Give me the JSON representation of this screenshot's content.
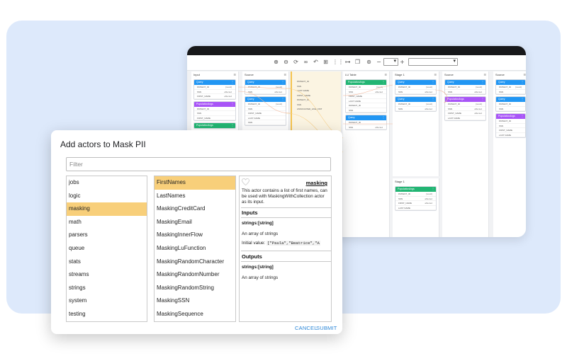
{
  "editor": {
    "columns": [
      {
        "title": "Input",
        "nodes": [
          {
            "title": "Query",
            "color": "#2196f3",
            "rows": [
              [
                "PATIENT_ID",
                "[result]"
              ],
              [
                "SSN",
                "affected"
              ],
              [
                "FIRST_NAME",
                "affected"
              ]
            ]
          },
          {
            "title": "PopulationArgs",
            "color": "#a855f7",
            "rows": [
              [
                "PATIENT_ID",
                ""
              ],
              [
                "SSN",
                ""
              ],
              [
                "FIRST_NAME",
                ""
              ]
            ]
          },
          {
            "title": "PopulationArgs",
            "color": "#22b573",
            "rows": []
          }
        ]
      },
      {
        "title": "Source",
        "nodes": [
          {
            "title": "Query",
            "color": "#2196f3",
            "rows": [
              [
                "PATIENT_ID",
                "[result]"
              ],
              [
                "SSN",
                "affected"
              ]
            ]
          },
          {
            "title": "Query",
            "color": "#2196f3",
            "rows": [
              [
                "PATIENT_ID",
                "[result]"
              ],
              [
                "SSN",
                ""
              ],
              [
                "FIRST_NAME",
                ""
              ],
              [
                "LAST NAME",
                ""
              ],
              [
                "SSN",
                ""
              ]
            ]
          }
        ]
      },
      {
        "title": "",
        "nodes": [
          {
            "title": "",
            "color": "",
            "rows": [
              [
                "PATIENT_ID",
                ""
              ],
              [
                "SSN",
                ""
              ],
              [
                "LAST NAME",
                ""
              ],
              [
                "FIRST_NAME",
                ""
              ],
              [
                "PATIENT_ID",
                ""
              ],
              [
                "SSN",
                ""
              ],
              [
                "ASSOCIATED_LINE_FMT",
                ""
              ]
            ]
          }
        ]
      },
      {
        "title": "LU Table",
        "nodes": [
          {
            "title": "PopulationArgs",
            "color": "#22b573",
            "rows": [
              [
                "PATIENT_ID",
                "[result]"
              ],
              [
                "SSN",
                "affected"
              ],
              [
                "FIRST_NAME",
                ""
              ],
              [
                "LAST NAME",
                ""
              ],
              [
                "PATIENT_ID",
                ""
              ],
              [
                "SSN",
                ""
              ]
            ]
          },
          {
            "title": "Query",
            "color": "#2196f3",
            "rows": [
              [
                "PATIENT_ID",
                ""
              ],
              [
                "SSN",
                "affected"
              ]
            ]
          }
        ]
      },
      {
        "title": "Stage 1",
        "nodes": [
          {
            "title": "Query",
            "color": "#2196f3",
            "rows": [
              [
                "PATIENT_ID",
                "[result]"
              ],
              [
                "SSN",
                "affected"
              ]
            ]
          },
          {
            "title": "Query",
            "color": "#2196f3",
            "rows": [
              [
                "PATIENT_ID",
                "[result]"
              ],
              [
                "SSN",
                "affected"
              ]
            ]
          }
        ]
      },
      {
        "title": "Source",
        "nodes": [
          {
            "title": "Query",
            "color": "#2196f3",
            "rows": [
              [
                "PATIENT_ID",
                "[result]"
              ],
              [
                "SSN",
                "affected"
              ]
            ]
          },
          {
            "title": "PopulationArgs",
            "color": "#a855f7",
            "rows": [
              [
                "PATIENT_ID",
                "[result]"
              ],
              [
                "SSN",
                "affected"
              ],
              [
                "FIRST_NAME",
                "affected"
              ],
              [
                "LAST NAME",
                ""
              ]
            ]
          }
        ]
      },
      {
        "title": "Source",
        "nodes": [
          {
            "title": "Query",
            "color": "#2196f3",
            "rows": [
              [
                "PATIENT_ID",
                "[result]"
              ],
              [
                "SSN",
                ""
              ]
            ]
          },
          {
            "title": "Query",
            "color": "#2196f3",
            "rows": [
              [
                "PATIENT_ID",
                ""
              ],
              [
                "SSN",
                ""
              ]
            ]
          },
          {
            "title": "PopulationArgs",
            "color": "#a855f7",
            "rows": [
              [
                "PATIENT_ID",
                ""
              ],
              [
                "SSN",
                ""
              ],
              [
                "FIRST_NAME",
                ""
              ],
              [
                "LAST NAME",
                ""
              ]
            ]
          }
        ]
      }
    ],
    "stage2": {
      "title": "Stage 1",
      "node": {
        "title": "PopulationArgs",
        "color": "#22b573",
        "rows": [
          [
            "PATIENT_ID",
            "[result]"
          ],
          [
            "SSN",
            "affected"
          ],
          [
            "FIRST_NAME",
            "affected"
          ],
          [
            "LAST NAME",
            ""
          ]
        ]
      }
    }
  },
  "dialog": {
    "title": "Add actors to Mask PII",
    "filter_placeholder": "Filter",
    "categories": [
      "jobs",
      "logic",
      "masking",
      "math",
      "parsers",
      "queue",
      "stats",
      "streams",
      "strings",
      "system",
      "testing"
    ],
    "selected_category": "masking",
    "actors": [
      "FirstNames",
      "LastNames",
      "MaskingCreditCard",
      "MaskingEmail",
      "MaskingInnerFlow",
      "MaskingLuFunction",
      "MaskingRandomCharacter",
      "MaskingRandomNumber",
      "MaskingRandomString",
      "MaskingSSN",
      "MaskingSequence"
    ],
    "selected_actor": "FirstNames",
    "doc": {
      "name": "masking",
      "description": "This actor contains a list of first names, can be used with MaskingWithCollection actor as its input.",
      "inputs_heading": "Inputs",
      "input_type": "strings:[string]",
      "input_desc": "An array of strings",
      "initial_label": "Initial value:",
      "initial_value": "[\"Paula\",\"Beatrice\",\"A",
      "outputs_heading": "Outputs",
      "output_type": "strings:[string]",
      "output_desc": "An array of strings"
    },
    "cancel_label": "CANCEL",
    "submit_label": "SUBMIT"
  }
}
